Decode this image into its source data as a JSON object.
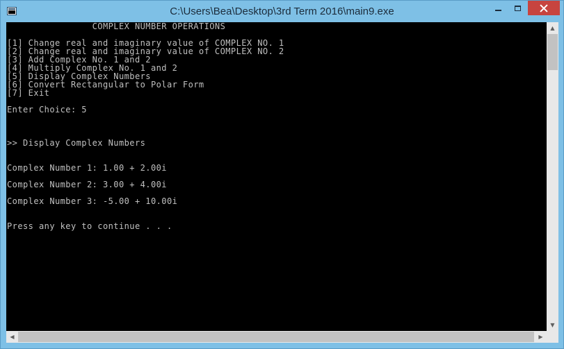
{
  "window": {
    "title": "C:\\Users\\Bea\\Desktop\\3rd Term 2016\\main9.exe"
  },
  "console": {
    "lines": [
      "                COMPLEX NUMBER OPERATIONS",
      "",
      "[1] Change real and imaginary value of COMPLEX NO. 1",
      "[2] Change real and imaginary value of COMPLEX NO. 2",
      "[3] Add Complex No. 1 and 2",
      "[4] Multiply Complex No. 1 and 2",
      "[5] Display Complex Numbers",
      "[6] Convert Rectangular to Polar Form",
      "[7] Exit",
      "",
      "Enter Choice: 5",
      "",
      "",
      "",
      ">> Display Complex Numbers",
      "",
      "",
      "Complex Number 1: 1.00 + 2.00i",
      "",
      "Complex Number 2: 3.00 + 4.00i",
      "",
      "Complex Number 3: -5.00 + 10.00i",
      "",
      "",
      "Press any key to continue . . ."
    ]
  },
  "colors": {
    "titlebar": "#7ec0e6",
    "console_bg": "#000000",
    "console_text": "#c0c0c0",
    "close_button": "#c7443f"
  },
  "icons": {
    "app": "console-app-icon",
    "minimize": "minimize-icon",
    "maximize": "maximize-icon",
    "close": "close-icon"
  }
}
